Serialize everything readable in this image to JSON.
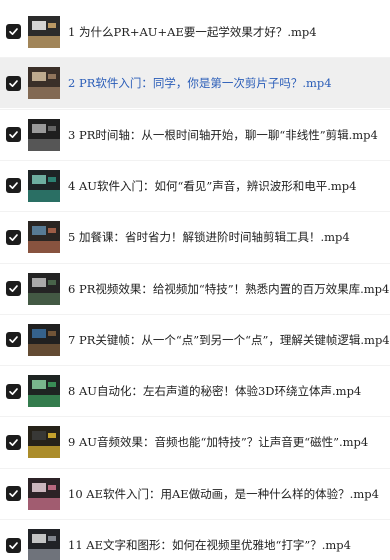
{
  "file_list": {
    "items": [
      {
        "title": "1 为什么PR+AU+AE要一起学效果才好？.mp4",
        "checked": true,
        "thumbnail": "video-thumbnail-overlay-text",
        "highlighted": false,
        "link_color": false,
        "thumb_colors": [
          "#2b2b2b",
          "#c9a46a",
          "#f2f2f2"
        ]
      },
      {
        "title": "2 PR软件入门：同学，你是第一次剪片子吗？.mp4",
        "checked": true,
        "thumbnail": "video-thumbnail-hand",
        "highlighted": true,
        "link_color": true,
        "thumb_colors": [
          "#3a2f28",
          "#9b7d62",
          "#d6c0a0"
        ]
      },
      {
        "title": "3 PR时间轴：从一根时间轴开始，聊一聊“非线性”剪辑.mp4",
        "checked": true,
        "thumbnail": "video-thumbnail-timeline",
        "highlighted": false,
        "link_color": false,
        "thumb_colors": [
          "#1f1f1f",
          "#6a6a6a",
          "#b0b0b0"
        ]
      },
      {
        "title": "4 AU软件入门：如何“看见”声音，辨识波形和电平.mp4",
        "checked": true,
        "thumbnail": "video-thumbnail-waveform",
        "highlighted": false,
        "link_color": false,
        "thumb_colors": [
          "#1d2325",
          "#2f8a7a",
          "#7cc7b6"
        ]
      },
      {
        "title": "5 加餐课：省时省力！解锁进阶时间轴剪辑工具！.mp4",
        "checked": true,
        "thumbnail": "video-thumbnail-editing",
        "highlighted": false,
        "link_color": false,
        "thumb_colors": [
          "#2a2522",
          "#a8634a",
          "#5f89a8"
        ]
      },
      {
        "title": "6 PR视频效果：给视频加“特技”！熟悉内置的百万效果库.mp4",
        "checked": true,
        "thumbnail": "video-thumbnail-effects",
        "highlighted": false,
        "link_color": false,
        "thumb_colors": [
          "#242424",
          "#4d6b4f",
          "#c2c2c2"
        ]
      },
      {
        "title": "7 PR关键帧：从一个“点”到另一个“点”，理解关键帧逻辑.mp4",
        "checked": true,
        "thumbnail": "video-thumbnail-keyframe",
        "highlighted": false,
        "link_color": false,
        "thumb_colors": [
          "#202020",
          "#7a5a3a",
          "#3a6fa0"
        ]
      },
      {
        "title": "8 AU自动化：左右声道的秘密！体验3D环绕立体声.mp4",
        "checked": true,
        "thumbnail": "video-thumbnail-audio-mixer",
        "highlighted": false,
        "link_color": false,
        "thumb_colors": [
          "#1e2422",
          "#3c9a5c",
          "#8ad0a0"
        ]
      },
      {
        "title": "9 AU音频效果：音频也能“加特技”？让声音更“磁性”.mp4",
        "checked": true,
        "thumbnail": "video-thumbnail-audio-effects",
        "highlighted": false,
        "link_color": false,
        "thumb_colors": [
          "#262219",
          "#d8b030",
          "#3c3c3c"
        ]
      },
      {
        "title": "10 AE软件入门：用AE做动画，是一种什么样的体验？.mp4",
        "checked": true,
        "thumbnail": "video-thumbnail-animation",
        "highlighted": false,
        "link_color": false,
        "thumb_colors": [
          "#2c2226",
          "#c8708a",
          "#e8d0d8"
        ]
      },
      {
        "title": "11 AE文字和图形：如何在视频里优雅地“打字”？.mp4",
        "checked": true,
        "thumbnail": "video-thumbnail-typography",
        "highlighted": false,
        "link_color": false,
        "thumb_colors": [
          "#202226",
          "#8a8f98",
          "#e0e0e0"
        ]
      }
    ]
  }
}
